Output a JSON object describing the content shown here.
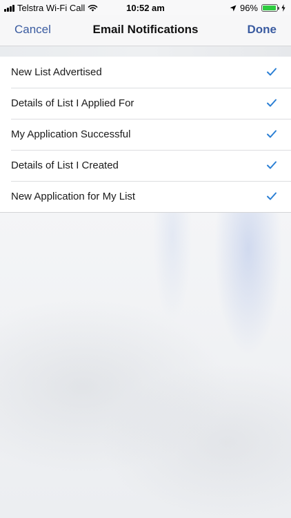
{
  "status_bar": {
    "carrier": "Telstra Wi-Fi Call",
    "time": "10:52 am",
    "battery_percent": "96%",
    "battery_level": 0.96,
    "icons": [
      "signal-icon",
      "wifi-icon",
      "location-arrow-icon",
      "battery-icon",
      "charging-bolt-icon"
    ]
  },
  "nav": {
    "cancel_label": "Cancel",
    "title": "Email Notifications",
    "done_label": "Done"
  },
  "notifications": [
    {
      "label": "New List Advertised",
      "checked": true
    },
    {
      "label": "Details of List I Applied For",
      "checked": true
    },
    {
      "label": "My Application Successful",
      "checked": true
    },
    {
      "label": "Details of List I Created",
      "checked": true
    },
    {
      "label": "New Application for My List",
      "checked": true
    }
  ],
  "colors": {
    "accent": "#3a5ba0",
    "checkmark": "#2a7fd4",
    "battery": "#2ecc40"
  }
}
